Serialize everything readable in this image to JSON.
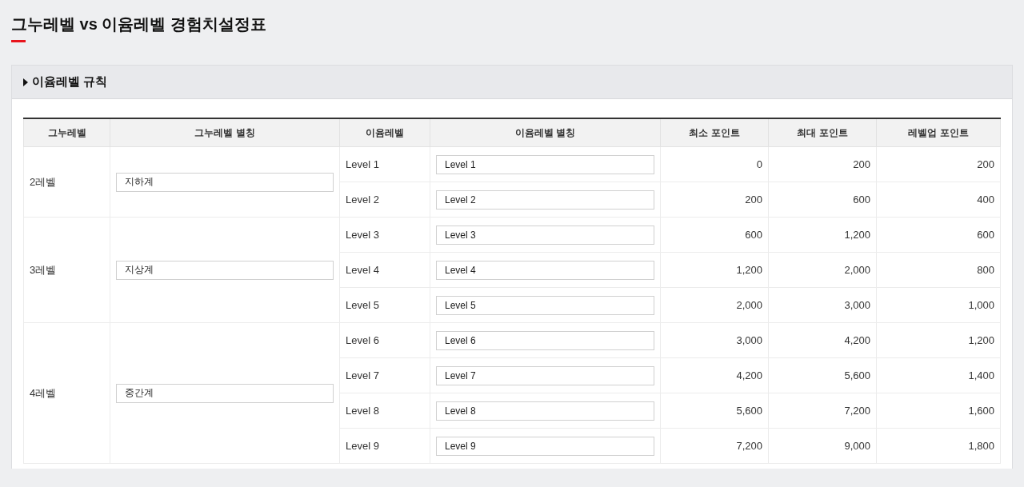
{
  "title": "그누레벨 vs 이윰레벨 경험치설정표",
  "section": {
    "title": "이윰레벨 규칙",
    "expanded": false
  },
  "table": {
    "columns": [
      "그누레벨",
      "그누레벨 별칭",
      "이윰레벨",
      "이윰레벨 별칭",
      "최소 포인트",
      "최대 포인트",
      "레벨업 포인트"
    ],
    "groups": [
      {
        "level": "2레벨",
        "alias": "지하계",
        "rows": [
          {
            "level": "Level 1",
            "alias": "Level 1",
            "min": "0",
            "max": "200",
            "up": "200"
          },
          {
            "level": "Level 2",
            "alias": "Level 2",
            "min": "200",
            "max": "600",
            "up": "400"
          }
        ]
      },
      {
        "level": "3레벨",
        "alias": "지상계",
        "rows": [
          {
            "level": "Level 3",
            "alias": "Level 3",
            "min": "600",
            "max": "1,200",
            "up": "600"
          },
          {
            "level": "Level 4",
            "alias": "Level 4",
            "min": "1,200",
            "max": "2,000",
            "up": "800"
          },
          {
            "level": "Level 5",
            "alias": "Level 5",
            "min": "2,000",
            "max": "3,000",
            "up": "1,000"
          }
        ]
      },
      {
        "level": "4레벨",
        "alias": "중간계",
        "rows": [
          {
            "level": "Level 6",
            "alias": "Level 6",
            "min": "3,000",
            "max": "4,200",
            "up": "1,200"
          },
          {
            "level": "Level 7",
            "alias": "Level 7",
            "min": "4,200",
            "max": "5,600",
            "up": "1,400"
          },
          {
            "level": "Level 8",
            "alias": "Level 8",
            "min": "5,600",
            "max": "7,200",
            "up": "1,600"
          },
          {
            "level": "Level 9",
            "alias": "Level 9",
            "min": "7,200",
            "max": "9,000",
            "up": "1,800"
          }
        ]
      }
    ]
  }
}
